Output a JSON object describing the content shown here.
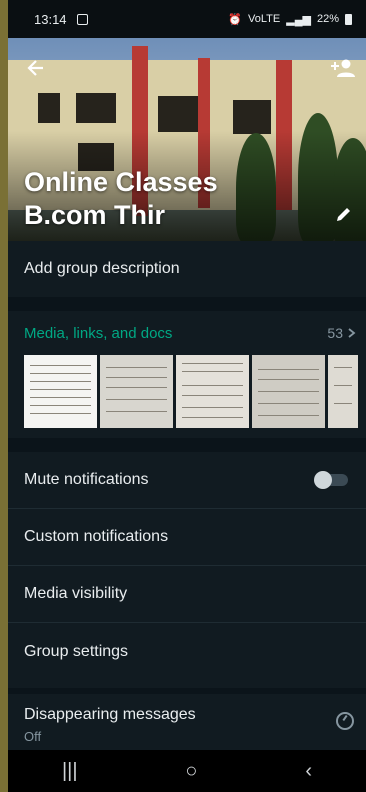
{
  "status_bar": {
    "time": "13:14",
    "signal_text": "VoLTE",
    "battery": "22%"
  },
  "group": {
    "name": "Online Classes\nB.com Thir"
  },
  "description": {
    "label": "Add group description"
  },
  "media": {
    "label": "Media, links, and docs",
    "count": "53",
    "count_icon": "chevron-right-icon"
  },
  "settings": [
    {
      "label": "Mute notifications"
    },
    {
      "label": "Custom notifications"
    },
    {
      "label": "Media visibility"
    },
    {
      "label": "Group settings"
    }
  ],
  "mute_toggle": {
    "on": false
  },
  "disappearing": {
    "label": "Disappearing messages",
    "value": "Off",
    "icon": "timer-icon"
  },
  "nav": {
    "recents": "|||",
    "home": "○",
    "back": "‹"
  },
  "colors": {
    "accent": "#00a884",
    "background": "#0b141a",
    "panel": "#111b21"
  }
}
